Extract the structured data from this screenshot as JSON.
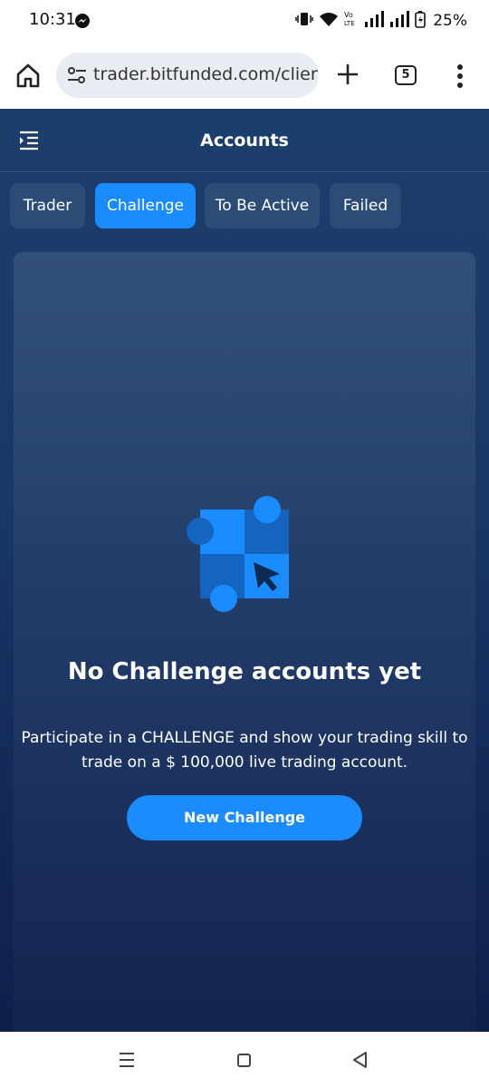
{
  "status_bar": {
    "time": "10:31",
    "battery": "25%",
    "icons": [
      "messenger-icon",
      "vibrate-icon",
      "wifi-icon",
      "volte-icon",
      "signal-icon",
      "signal-icon",
      "battery-icon"
    ]
  },
  "browser": {
    "url": "trader.bitfunded.com/clier",
    "tab_count": "5"
  },
  "app": {
    "title": "Accounts",
    "tabs": [
      {
        "label": "Trader",
        "active": false
      },
      {
        "label": "Challenge",
        "active": true
      },
      {
        "label": "To Be Active",
        "active": false
      },
      {
        "label": "Failed",
        "active": false
      }
    ],
    "empty_state": {
      "title": "No Challenge accounts yet",
      "description": "Participate in a CHALLENGE and show your trading skill to trade on a $ 100,000 live trading account.",
      "button_label": "New Challenge"
    }
  },
  "colors": {
    "accent": "#1a8cff",
    "background_top": "#1c3e6c",
    "background_bottom": "#0f1f4a"
  }
}
